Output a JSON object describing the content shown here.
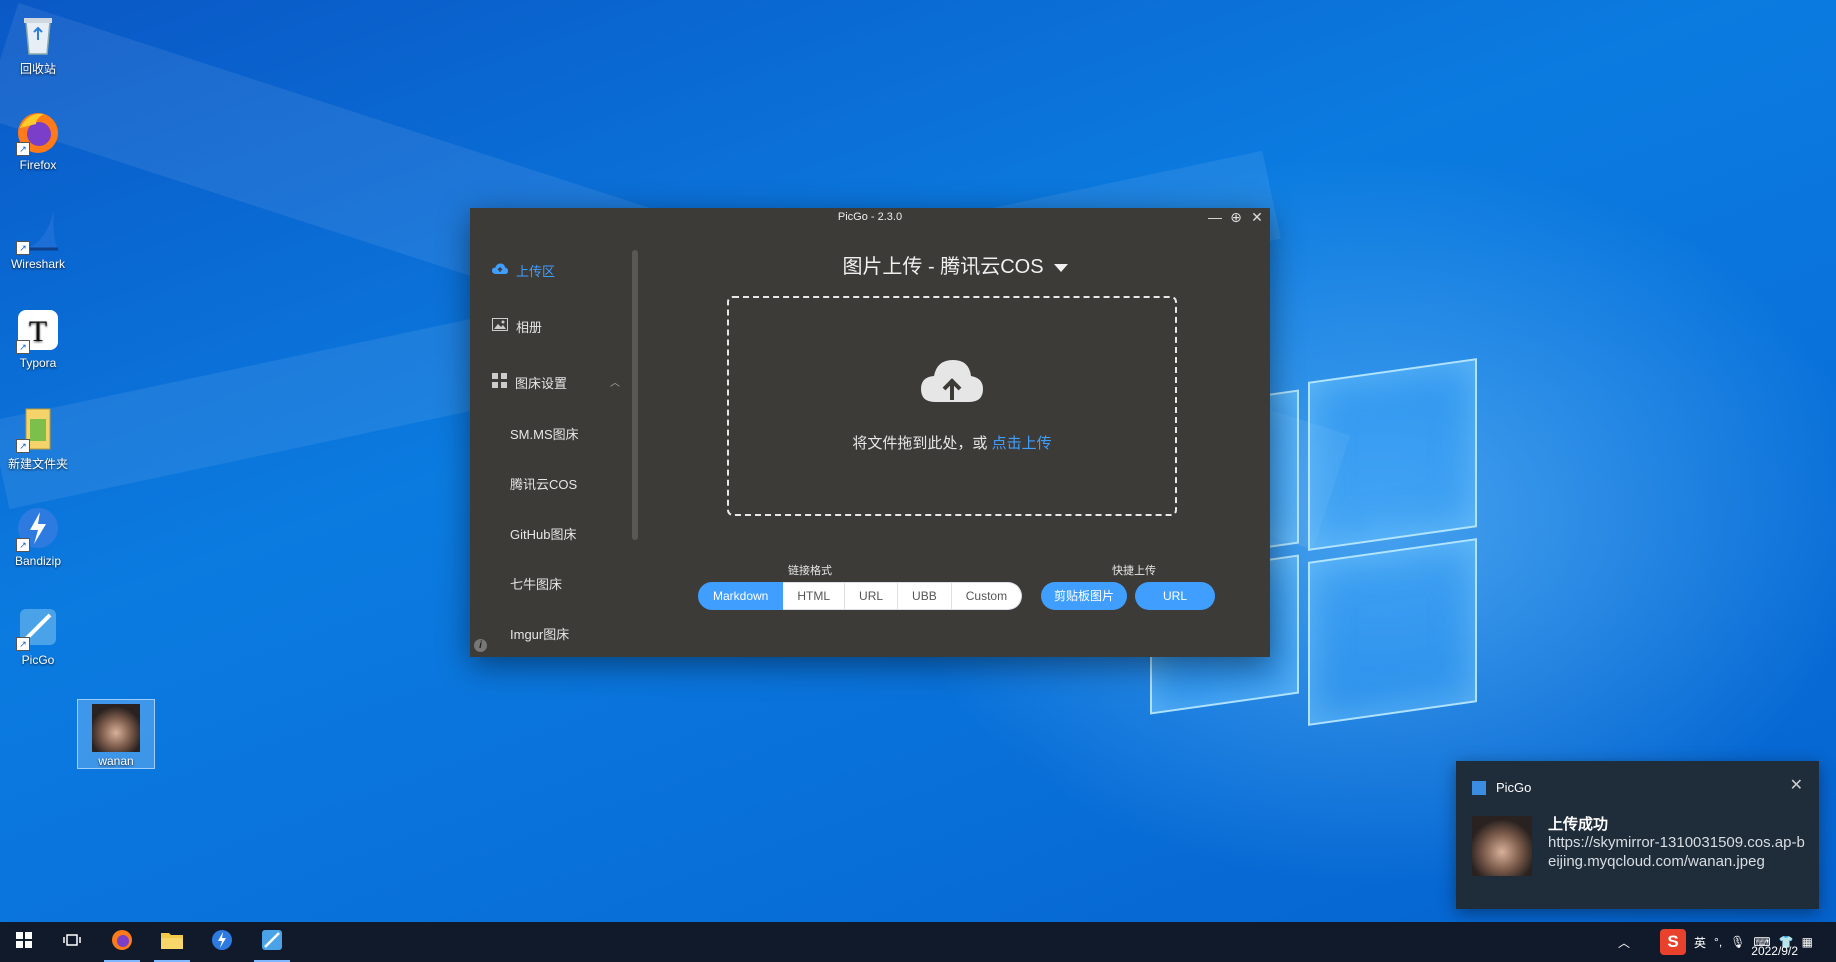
{
  "desktop": {
    "icons": [
      {
        "label": "回收站",
        "icon": "recycle-bin-icon"
      },
      {
        "label": "Firefox",
        "icon": "firefox-icon"
      },
      {
        "label": "Wireshark",
        "icon": "wireshark-icon"
      },
      {
        "label": "Typora",
        "icon": "typora-icon"
      },
      {
        "label": "新建文件夹",
        "icon": "folder-icon"
      },
      {
        "label": "Bandizip",
        "icon": "bandizip-icon"
      },
      {
        "label": "PicGo",
        "icon": "picgo-icon"
      },
      {
        "label": "wanan",
        "icon": "image-file-icon"
      }
    ]
  },
  "picgo": {
    "window_title": "PicGo - 2.3.0",
    "controls": {
      "minimize": "—",
      "pin": "⊕",
      "close": "✕"
    },
    "sidebar": {
      "upload": "上传区",
      "gallery": "相册",
      "settings": "图床设置",
      "sub_items": [
        "SM.MS图床",
        "腾讯云COS",
        "GitHub图床",
        "七牛图床",
        "Imgur图床"
      ]
    },
    "main": {
      "title": "图片上传 - 腾讯云COS",
      "drop_text": "将文件拖到此处，或",
      "drop_link": "点击上传",
      "link_format_label": "链接格式",
      "formats": [
        "Markdown",
        "HTML",
        "URL",
        "UBB",
        "Custom"
      ],
      "selected_format": "Markdown",
      "quick_upload_label": "快捷上传",
      "quick_buttons": [
        "剪贴板图片",
        "URL"
      ]
    }
  },
  "notification": {
    "app": "PicGo",
    "title": "上传成功",
    "body": "https://skymirror-1310031509.cos.ap-beijing.myqcloud.com/wanan.jpeg"
  },
  "taskbar": {
    "items": [
      "start-icon",
      "task-view-icon",
      "firefox-icon",
      "file-explorer-icon",
      "bandizip-icon",
      "picgo-icon"
    ],
    "ime_lang": "英",
    "date": "2022/9/2"
  }
}
